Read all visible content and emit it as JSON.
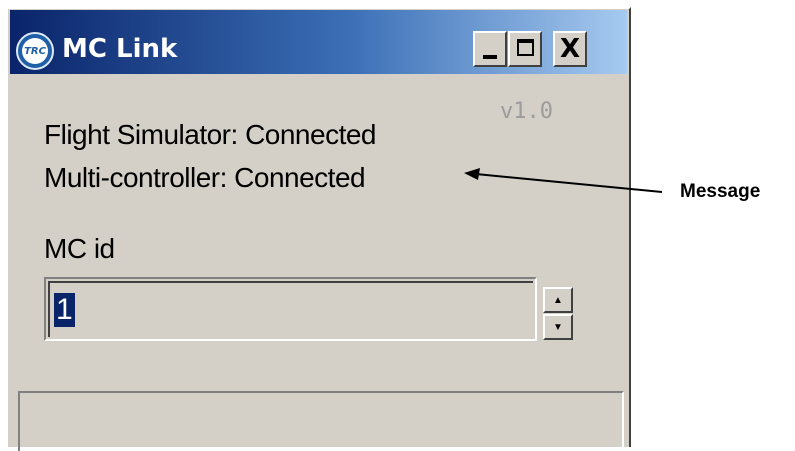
{
  "window": {
    "title": "MC Link",
    "icon_text": "TRC",
    "version": "v1.0"
  },
  "title_buttons": {
    "minimize": "minimize-icon",
    "maximize": "maximize-icon",
    "close": "X"
  },
  "status": {
    "flight_simulator": "Flight Simulator: Connected",
    "multi_controller": "Multi-controller: Connected"
  },
  "mc_id": {
    "label": "MC id",
    "value": "1"
  },
  "annotation": {
    "label": "Message"
  },
  "colors": {
    "titlebar_start": "#0a246a",
    "titlebar_end": "#a6caf0",
    "window_bg": "#d4d0c8",
    "selection": "#0a246a"
  }
}
